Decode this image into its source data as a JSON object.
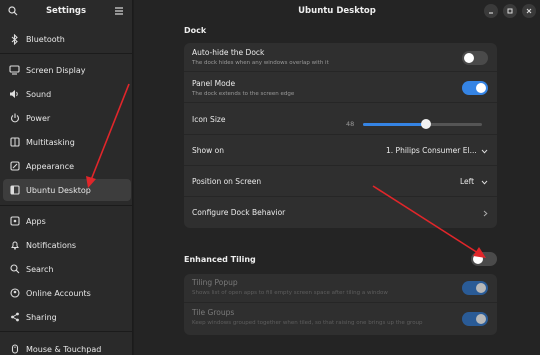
{
  "sidebar": {
    "title": "Settings",
    "items": [
      {
        "label": "Bluetooth",
        "icon": "bluetooth-icon"
      },
      {
        "label": "Screen Display",
        "icon": "display-icon"
      },
      {
        "label": "Sound",
        "icon": "speaker-icon"
      },
      {
        "label": "Power",
        "icon": "power-icon"
      },
      {
        "label": "Multitasking",
        "icon": "multitasking-icon"
      },
      {
        "label": "Appearance",
        "icon": "appearance-icon"
      },
      {
        "label": "Ubuntu Desktop",
        "icon": "ubuntu-desktop-icon",
        "active": true
      },
      {
        "label": "Apps",
        "icon": "apps-icon"
      },
      {
        "label": "Notifications",
        "icon": "bell-icon"
      },
      {
        "label": "Search",
        "icon": "search-icon"
      },
      {
        "label": "Online Accounts",
        "icon": "online-accounts-icon"
      },
      {
        "label": "Sharing",
        "icon": "share-icon"
      },
      {
        "label": "Mouse & Touchpad",
        "icon": "mouse-icon"
      }
    ]
  },
  "window": {
    "title": "Ubuntu Desktop"
  },
  "dock": {
    "section_title": "Dock",
    "auto_hide": {
      "title": "Auto-hide the Dock",
      "subtitle": "The dock hides when any windows overlap with it",
      "enabled": false
    },
    "panel_mode": {
      "title": "Panel Mode",
      "subtitle": "The dock extends to the screen edge",
      "enabled": true
    },
    "icon_size": {
      "title": "Icon Size",
      "value": "48",
      "fraction": 0.53
    },
    "show_on": {
      "title": "Show on",
      "value": "1. Philips Consumer El..."
    },
    "position": {
      "title": "Position on Screen",
      "value": "Left"
    },
    "configure": {
      "title": "Configure Dock Behavior"
    }
  },
  "tiling": {
    "section_title": "Enhanced Tiling",
    "enabled": false,
    "popup": {
      "title": "Tiling Popup",
      "subtitle": "Shows list of open apps to fill empty screen space after tiling a window",
      "enabled": true
    },
    "groups": {
      "title": "Tile Groups",
      "subtitle": "Keep windows grouped together when tiled, so that raising one brings up the group",
      "enabled": true
    }
  },
  "colors": {
    "accent": "#3584e4",
    "annotation_arrow": "#e0262a"
  }
}
